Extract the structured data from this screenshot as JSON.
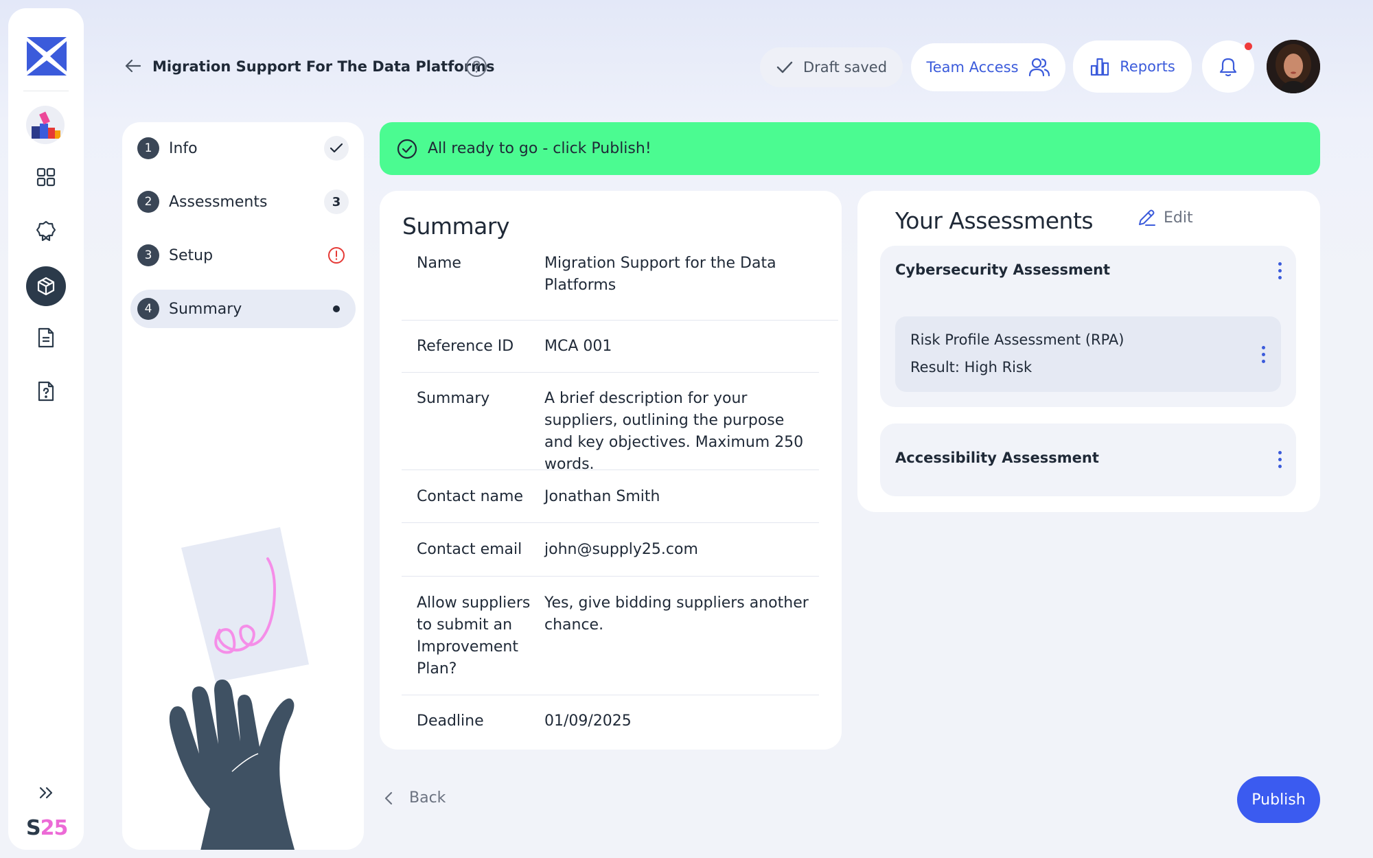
{
  "brand": {
    "text_s": "S",
    "text_num": "25"
  },
  "header": {
    "title": "Migration Support For The Data Platforms",
    "draft_status": "Draft saved",
    "team_access_label": "Team Access",
    "reports_label": "Reports"
  },
  "steps": [
    {
      "num": "1",
      "label": "Info",
      "badge": "check"
    },
    {
      "num": "2",
      "label": "Assessments",
      "badge": "3"
    },
    {
      "num": "3",
      "label": "Setup",
      "badge": "warning"
    },
    {
      "num": "4",
      "label": "Summary",
      "badge": "dot"
    }
  ],
  "banner": {
    "text": "All ready to go - click Publish!",
    "color": "#4bfb91"
  },
  "summary": {
    "title": "Summary",
    "rows": [
      {
        "label": "Name",
        "value": "Migration Support for the Data Platforms"
      },
      {
        "label": "Reference ID",
        "value": "MCA 001"
      },
      {
        "label": "Summary",
        "value": "A brief description for your suppliers, outlining the purpose and key objectives. Maximum 250 words."
      },
      {
        "label": "Contact name",
        "value": "Jonathan Smith"
      },
      {
        "label": "Contact email",
        "value": "john@supply25.com"
      },
      {
        "label": "Allow suppliers to submit an Improvement Plan?",
        "value": "Yes, give bidding suppliers another chance."
      },
      {
        "label": "Deadline",
        "value": "01/09/2025"
      }
    ]
  },
  "assessments": {
    "title": "Your Assessments",
    "edit_label": "Edit",
    "groups": [
      {
        "title": "Cybersecurity Assessment",
        "items": [
          {
            "title": "Risk Profile Assessment (RPA)",
            "result": "Result: High Risk"
          }
        ]
      },
      {
        "title": "Accessibility Assessment",
        "items": []
      }
    ]
  },
  "footer": {
    "back_label": "Back",
    "publish_label": "Publish"
  },
  "colors": {
    "accent": "#3b5bf0",
    "sidebar_active": "#2b3a4a",
    "warning": "#e53935",
    "brand_pink": "#ec6ad6"
  }
}
